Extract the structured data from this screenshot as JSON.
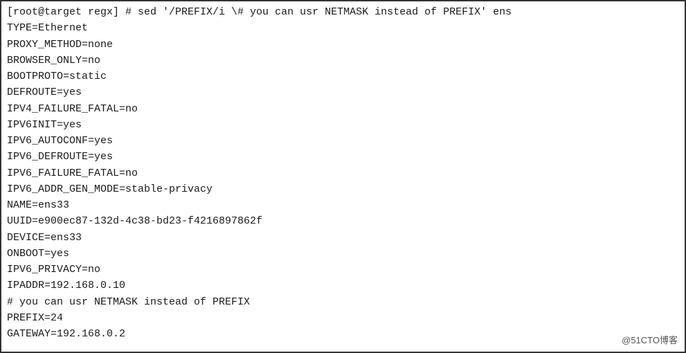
{
  "terminal": {
    "lines": [
      "[root@target regx] # sed '/PREFIX/i \\# you can usr NETMASK instead of PREFIX' ens",
      "TYPE=Ethernet",
      "PROXY_METHOD=none",
      "BROWSER_ONLY=no",
      "BOOTPROTO=static",
      "DEFROUTE=yes",
      "IPV4_FAILURE_FATAL=no",
      "IPV6INIT=yes",
      "IPV6_AUTOCONF=yes",
      "IPV6_DEFROUTE=yes",
      "IPV6_FAILURE_FATAL=no",
      "IPV6_ADDR_GEN_MODE=stable-privacy",
      "NAME=ens33",
      "UUID=e900ec87-132d-4c38-bd23-f4216897862f",
      "DEVICE=ens33",
      "ONBOOT=yes",
      "IPV6_PRIVACY=no",
      "IPADDR=192.168.0.10",
      "# you can usr NETMASK instead of PREFIX",
      "PREFIX=24",
      "GATEWAY=192.168.0.2"
    ],
    "watermark": "@51CTO博客"
  }
}
